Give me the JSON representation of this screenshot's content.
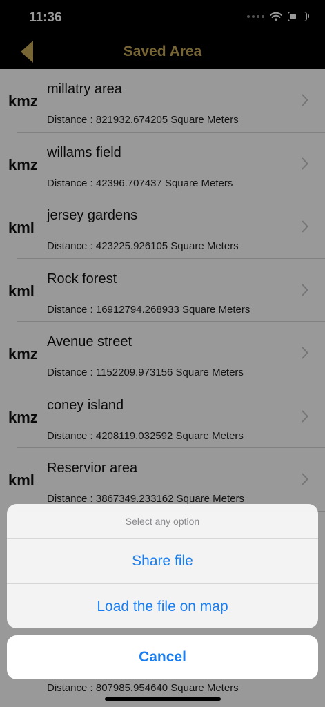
{
  "status": {
    "time": "11:36"
  },
  "nav": {
    "title": "Saved Area",
    "back_icon": "back-arrow-icon",
    "accent": "#c9a957"
  },
  "rows": [
    {
      "type": "kmz",
      "name": "millatry area",
      "distance": "Distance : 821932.674205 Square Meters"
    },
    {
      "type": "kmz",
      "name": "willams field",
      "distance": "Distance : 42396.707437 Square Meters"
    },
    {
      "type": "kml",
      "name": "jersey gardens",
      "distance": "Distance : 423225.926105 Square Meters"
    },
    {
      "type": "kml",
      "name": "Rock forest",
      "distance": "Distance : 16912794.268933 Square Meters"
    },
    {
      "type": "kmz",
      "name": "Avenue street",
      "distance": "Distance : 1152209.973156 Square Meters"
    },
    {
      "type": "kmz",
      "name": "coney island",
      "distance": "Distance : 4208119.032592 Square Meters"
    },
    {
      "type": "kml",
      "name": "Reservior area",
      "distance": "Distance : 3867349.233162 Square Meters"
    }
  ],
  "last_row": {
    "distance": "Distance : 807985.954640 Square Meters"
  },
  "action_sheet": {
    "header": "Select any option",
    "options": [
      "Share file",
      "Load the file on map"
    ],
    "cancel": "Cancel",
    "accent": "#1a7ef0"
  }
}
